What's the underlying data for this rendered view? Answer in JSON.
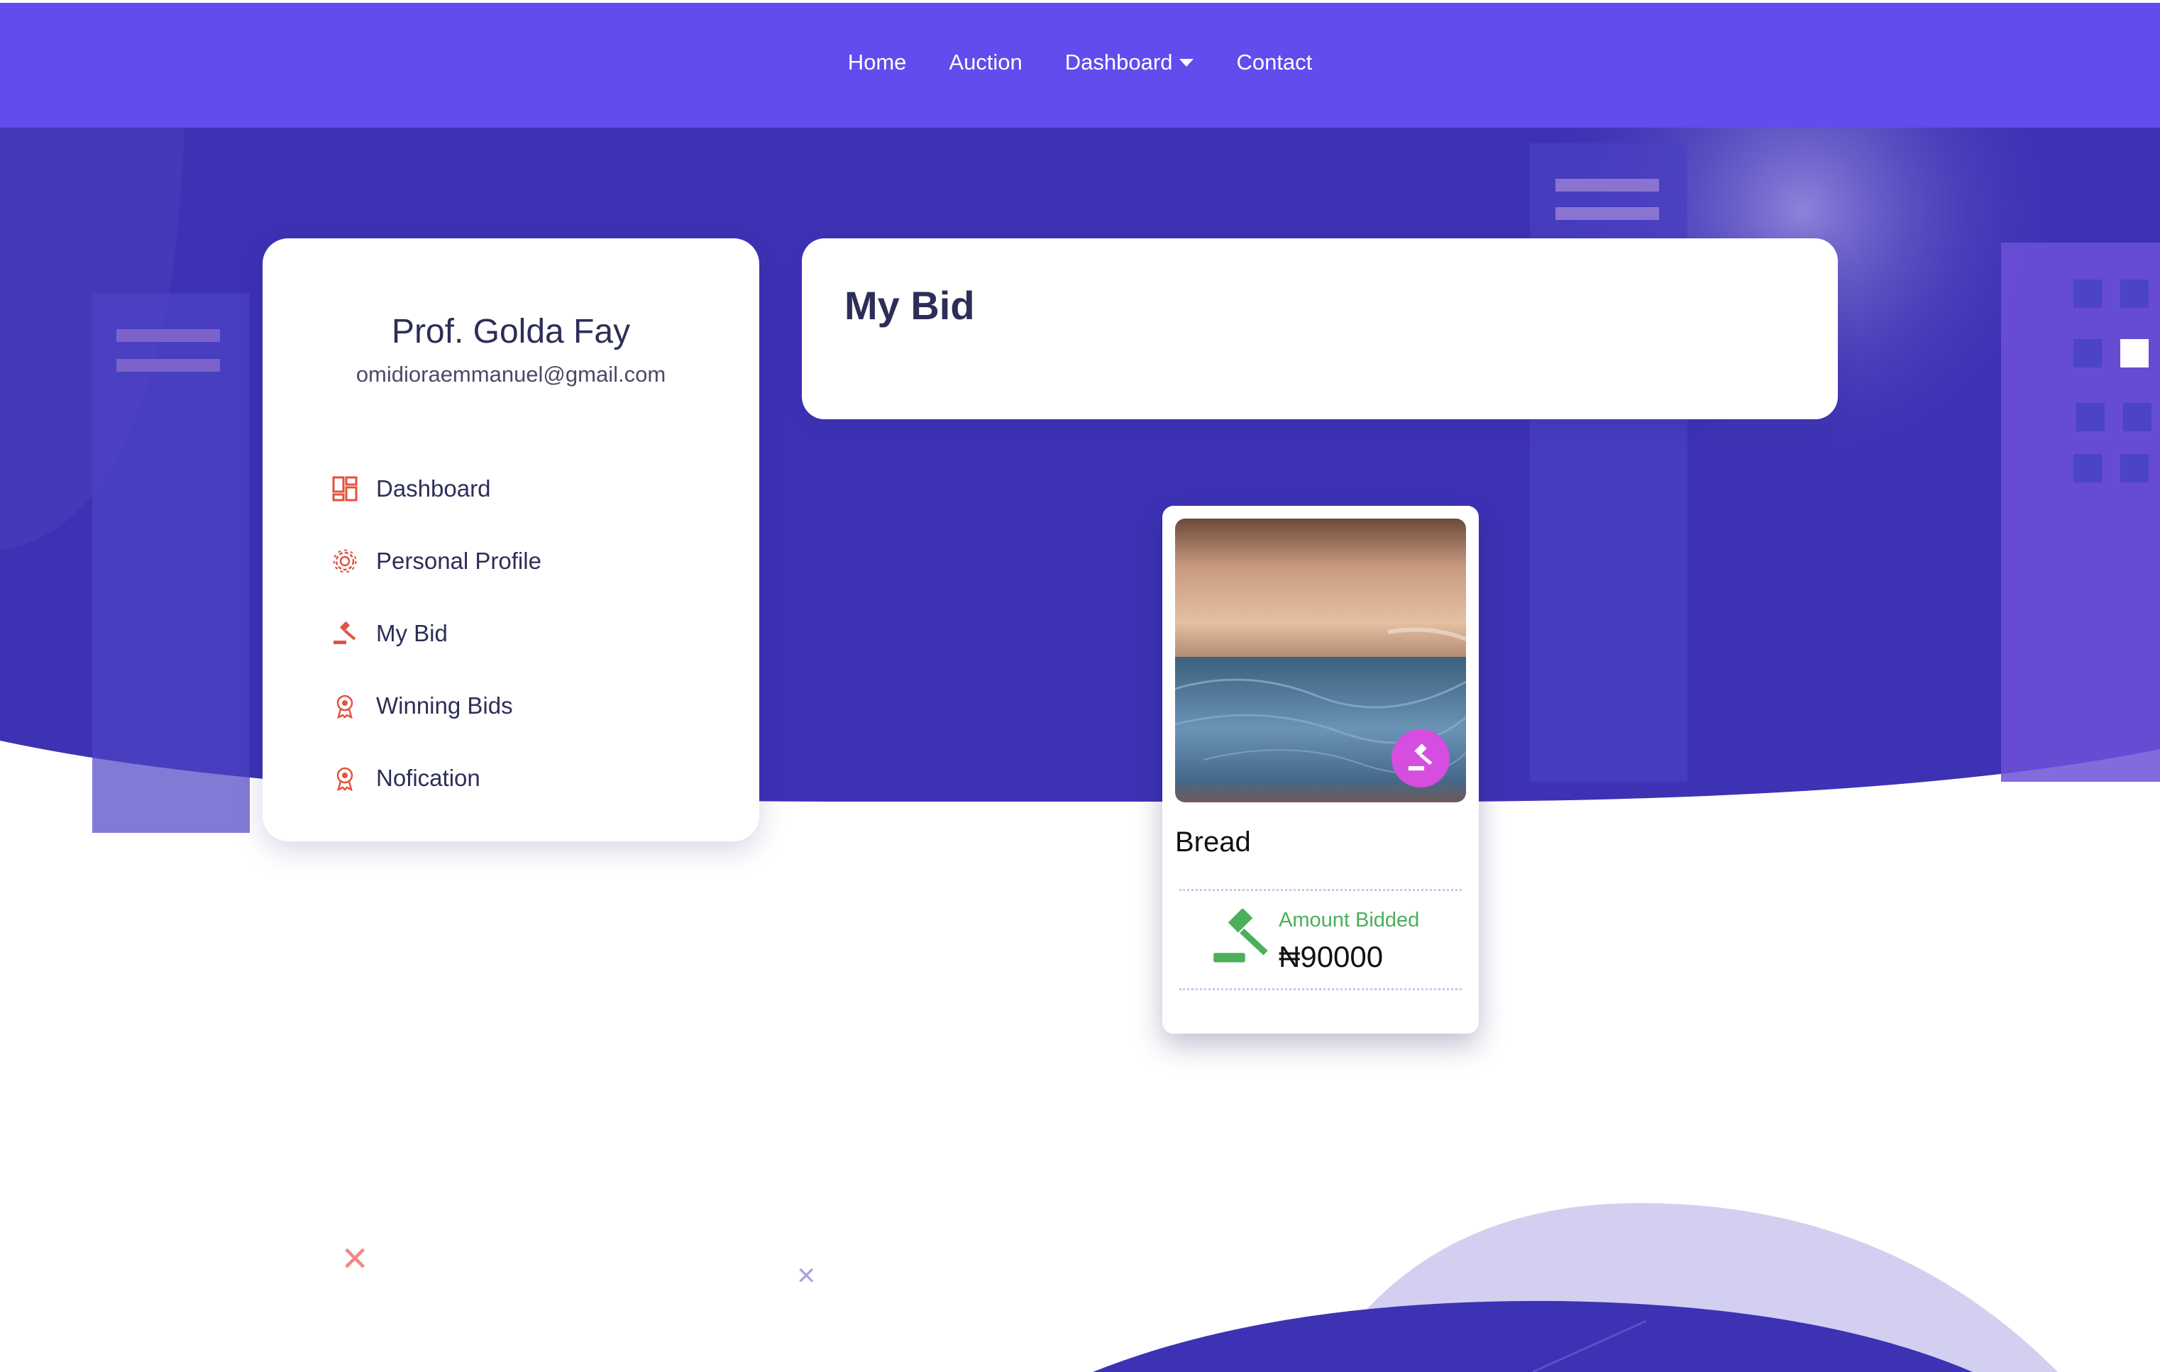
{
  "nav": {
    "items": [
      {
        "label": "Home"
      },
      {
        "label": "Auction"
      },
      {
        "label": "Dashboard",
        "has_dropdown": true
      },
      {
        "label": "Contact"
      }
    ]
  },
  "profile": {
    "name": "Prof. Golda Fay",
    "email": "omidioraemmanuel@gmail.com"
  },
  "sidebar": {
    "items": [
      {
        "label": "Dashboard",
        "icon": "dashboard-icon"
      },
      {
        "label": "Personal Profile",
        "icon": "gear-icon"
      },
      {
        "label": "My Bid",
        "icon": "gavel-icon"
      },
      {
        "label": "Winning Bids",
        "icon": "award-icon"
      },
      {
        "label": "Nofication",
        "icon": "award-icon"
      }
    ]
  },
  "page": {
    "title": "My Bid"
  },
  "bid": {
    "item_name": "Bread",
    "amount_label": "Amount Bidded",
    "amount_value": "₦90000",
    "badge_icon": "gavel-icon",
    "amount_icon": "gavel-icon"
  },
  "colors": {
    "nav_bg": "#614ced",
    "hero_bg": "#3d32b4",
    "accent_icon": "#e2523f",
    "badge": "#d64ee0",
    "amount_green": "#4caf5a",
    "text_dark": "#2d2e57"
  }
}
